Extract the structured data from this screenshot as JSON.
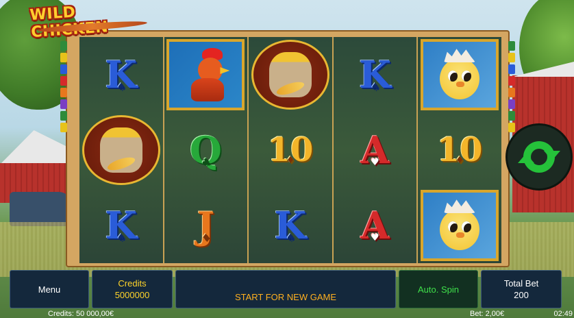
{
  "game": {
    "logo_text": "WILD CHICKEN"
  },
  "reels": [
    {
      "symbols": [
        "K",
        "sack",
        "K"
      ]
    },
    {
      "symbols": [
        "rooster",
        "Q",
        "J"
      ]
    },
    {
      "symbols": [
        "sack",
        "10",
        "K"
      ]
    },
    {
      "symbols": [
        "K",
        "A",
        "A"
      ]
    },
    {
      "symbols": [
        "chick",
        "10",
        "chick"
      ]
    }
  ],
  "symbol_labels": {
    "K": "K",
    "Q": "Q",
    "J": "J",
    "A": "A",
    "10": "10"
  },
  "panel": {
    "menu_label": "Menu",
    "credits_label": "Credits",
    "credits_value": "5000000",
    "message": "START FOR NEW GAME",
    "auto_spin_label": "Auto. Spin",
    "total_bet_label": "Total Bet",
    "total_bet_value": "200"
  },
  "status": {
    "credits_text": "Credits: 50 000,00€",
    "bet_text": "Bet: 2,00€",
    "clock": "02:49"
  },
  "colors": {
    "accent_green": "#25c23a",
    "panel_bg": "#14283c",
    "credits_color": "#ffd42a",
    "message_color": "#ffb020",
    "frame_gold": "#d4a662"
  },
  "icons": {
    "spin": "spin-refresh-icon"
  },
  "line_markers": {
    "colors": [
      "#2e8b3a",
      "#e7c21a",
      "#2a5cd8",
      "#d52a2a",
      "#e7771d",
      "#7a3fc4",
      "#2e8b3a",
      "#e7c21a"
    ]
  }
}
